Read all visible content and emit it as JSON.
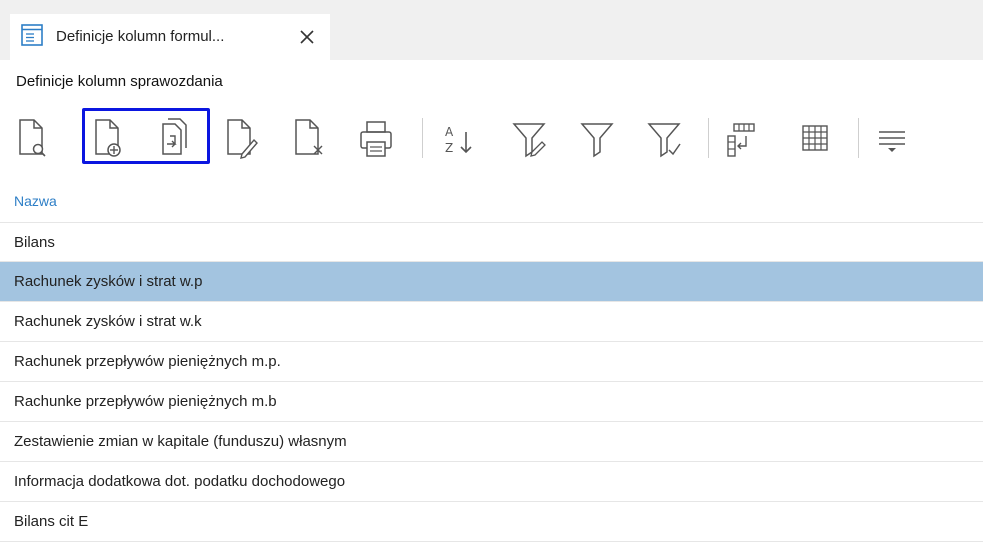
{
  "tab": {
    "title": "Definicje kolumn formul...",
    "icon": "list-window-icon"
  },
  "page": {
    "title": "Definicje kolumn sprawozdania"
  },
  "toolbar": {
    "buttons": [
      {
        "name": "preview-button",
        "icon": "document-search-icon"
      },
      {
        "name": "add-button",
        "icon": "document-add-icon"
      },
      {
        "name": "copy-button",
        "icon": "document-copy-icon"
      },
      {
        "name": "edit-button",
        "icon": "document-edit-icon"
      },
      {
        "name": "delete-button",
        "icon": "document-delete-icon"
      },
      {
        "name": "print-button",
        "icon": "printer-icon"
      },
      {
        "name": "sort-button",
        "icon": "sort-az-icon"
      },
      {
        "name": "filter-edit-button",
        "icon": "filter-edit-icon"
      },
      {
        "name": "filter-button",
        "icon": "filter-icon"
      },
      {
        "name": "filter-check-button",
        "icon": "filter-check-icon"
      },
      {
        "name": "columns-button",
        "icon": "column-layout-icon"
      },
      {
        "name": "grid-button",
        "icon": "grid-icon"
      },
      {
        "name": "more-button",
        "icon": "collapse-lines-icon"
      }
    ],
    "highlight_color": "#0b16e0"
  },
  "table": {
    "header": "Nazwa",
    "rows": [
      "Bilans",
      "Rachunek zysków i strat w.p",
      "Rachunek zysków i strat w.k",
      "Rachunek przepływów pieniężnych m.p.",
      "Rachunke przepływów pieniężnych m.b",
      "Zestawienie zmian w kapitale (funduszu) własnym",
      "Informacja dodatkowa dot. podatku dochodowego",
      "Bilans cit E"
    ],
    "selected_index": 1,
    "selected_color": "#a3c4e0",
    "header_color": "#2d7ec6"
  }
}
